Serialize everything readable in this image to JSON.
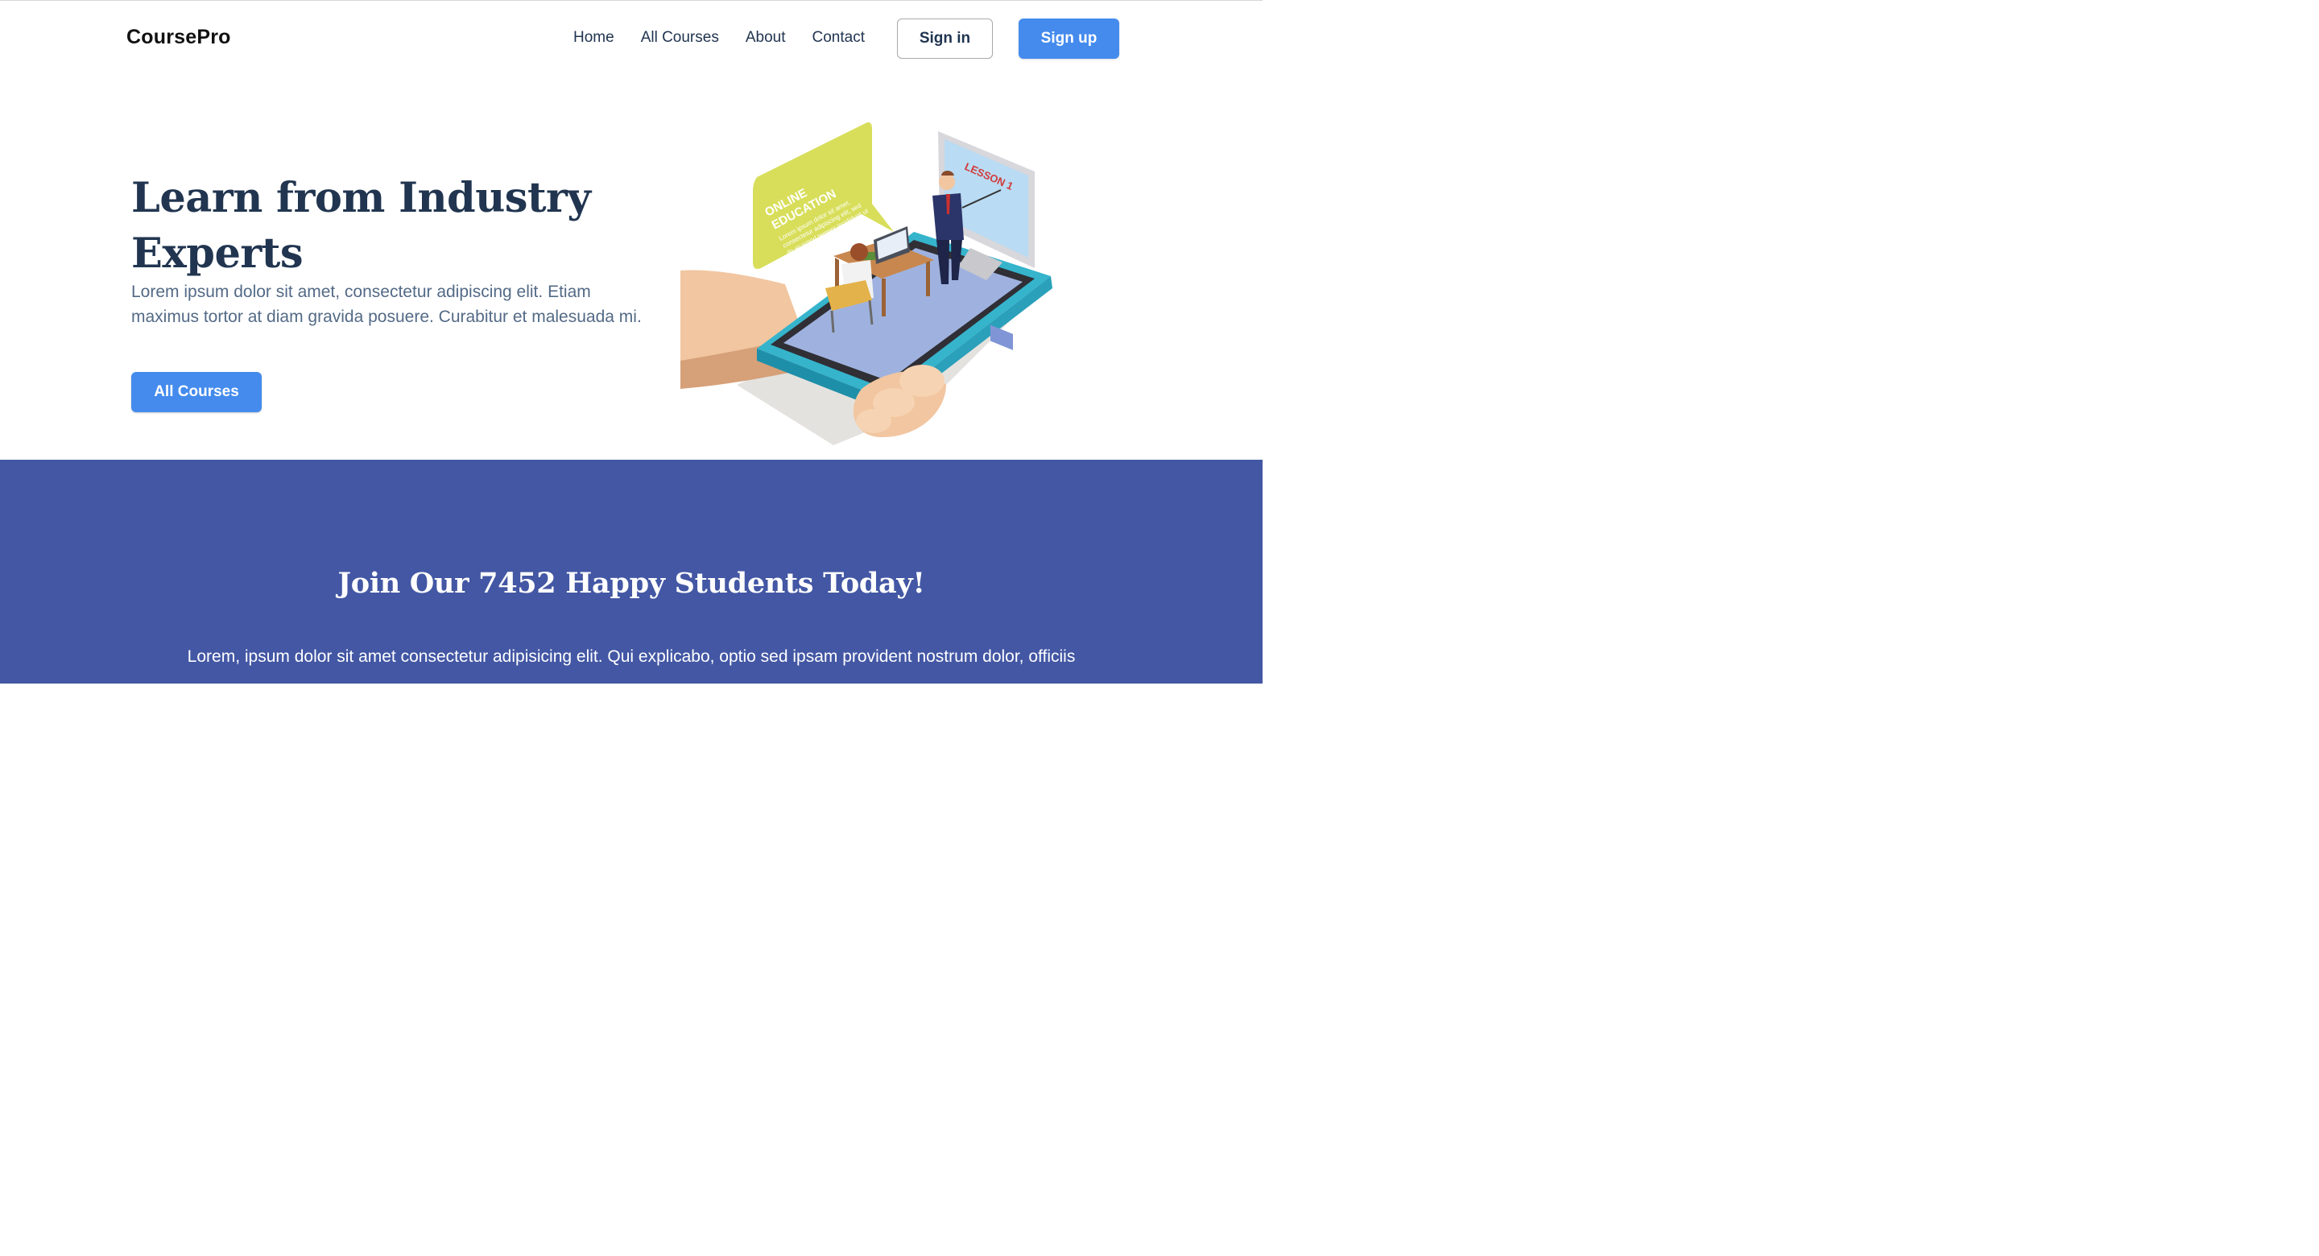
{
  "nav": {
    "logo": "CoursePro",
    "links": [
      "Home",
      "All Courses",
      "About",
      "Contact"
    ],
    "signin_label": "Sign in",
    "signup_label": "Sign up"
  },
  "hero": {
    "title": "Learn from Industry Experts",
    "text": "Lorem ipsum dolor sit amet, consectetur adipiscing elit. Etiam maximus tortor at diam gravida posuere. Curabitur et malesuada mi.",
    "cta_label": "All Courses",
    "illustration": {
      "bubble_title_line1": "ONLINE",
      "bubble_title_line2": "EDUCATION",
      "bubble_text_lines": [
        "Lorem ipsum dolor sit amet,",
        "consectetur adipiscing elit, sed",
        "do eiusmod tempor incididunt ut",
        "labore et dolore magna."
      ],
      "screen_label": "LESSON 1"
    }
  },
  "students": {
    "title": "Join Our 7452 Happy Students Today!",
    "text": "Lorem, ipsum dolor sit amet consectetur adipisicing elit. Qui explicabo, optio sed ipsam provident nostrum dolor, officiis"
  },
  "colors": {
    "primary": "#448bed",
    "heading": "#213550",
    "band": "#4357a4"
  }
}
